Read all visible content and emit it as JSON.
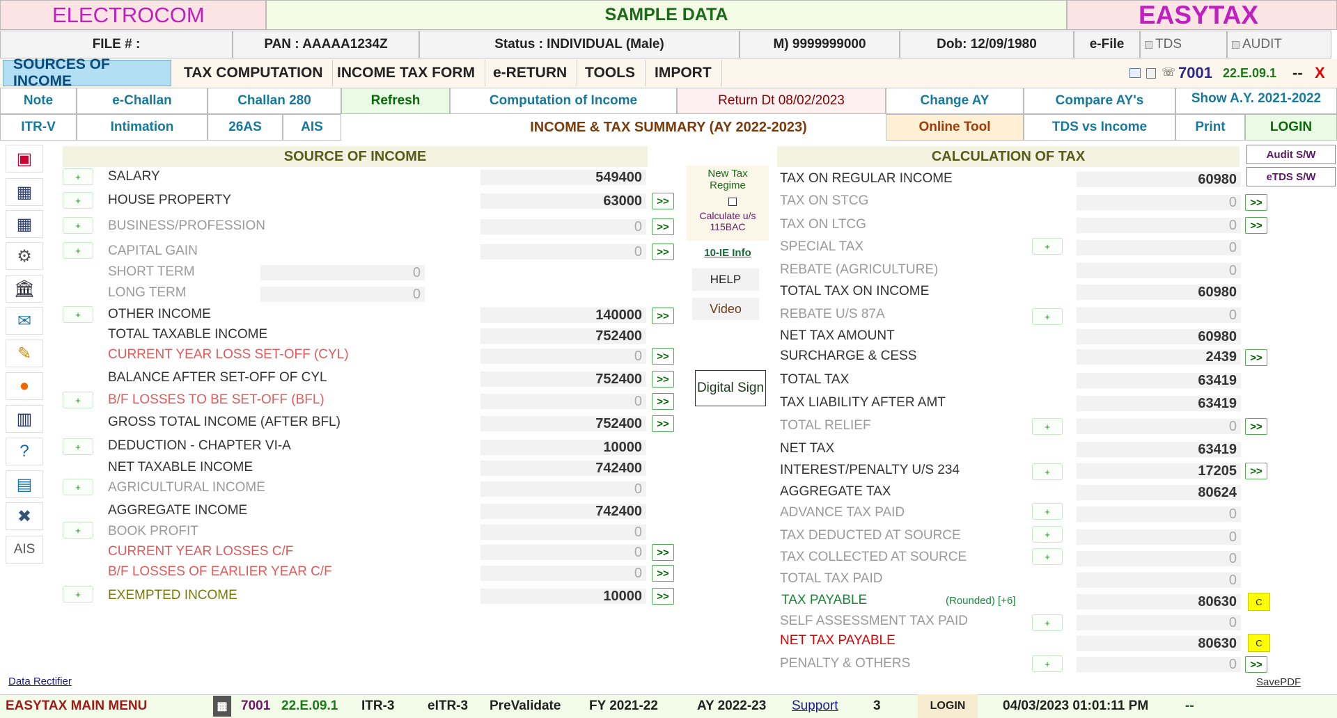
{
  "header": {
    "brand_left": "ELECTROCOM",
    "center": "SAMPLE DATA",
    "brand_right": "EASYTAX"
  },
  "info": {
    "file": "FILE # :",
    "pan": "PAN : AAAAA1234Z",
    "status": "Status : INDIVIDUAL (Male)",
    "mobile": "M) 9999999000",
    "dob": "Dob: 12/09/1980",
    "efile": "e-File",
    "tds": "TDS",
    "audit": "AUDIT"
  },
  "menu": {
    "sources": "SOURCES OF INCOME",
    "taxcomp": "TAX COMPUTATION",
    "itform": "INCOME TAX FORM",
    "ereturn": "e-RETURN",
    "tools": "TOOLS",
    "import": "IMPORT",
    "code": "7001",
    "version": "22.E.09.1",
    "dash": "--",
    "close": "X"
  },
  "buttons": {
    "note": "Note",
    "echallan": "e-Challan",
    "challan280": "Challan 280",
    "refresh": "Refresh",
    "comp": "Computation of Income",
    "returndt": "Return Dt 08/02/2023",
    "changeay": "Change AY",
    "compare": "Compare AY's",
    "showay": "Show A.Y. 2021-2022",
    "itrv": "ITR-V",
    "intimation": "Intimation",
    "26as": "26AS",
    "ais": "AIS",
    "summary": "INCOME & TAX SUMMARY (AY 2022-2023)",
    "online": "Online Tool",
    "tdsvs": "TDS vs Income",
    "print": "Print",
    "login": "LOGIN",
    "auditsw": "Audit S/W",
    "etdssw": "eTDS S/W"
  },
  "left": {
    "title": "SOURCE OF INCOME",
    "salary": "SALARY",
    "salary_v": "549400",
    "hp": "HOUSE PROPERTY",
    "hp_v": "63000",
    "bp": "BUSINESS/PROFESSION",
    "bp_v": "0",
    "cg": "CAPITAL GAIN",
    "cg_v": "0",
    "st": "SHORT TERM",
    "st_v": "0",
    "lt": "LONG TERM",
    "lt_v": "0",
    "oi": "OTHER INCOME",
    "oi_v": "140000",
    "tti": "TOTAL TAXABLE INCOME",
    "tti_v": "752400",
    "cyl": "CURRENT YEAR LOSS SET-OFF (CYL)",
    "cyl_v": "0",
    "bal": "BALANCE AFTER SET-OFF OF CYL",
    "bal_v": "752400",
    "bfl": "B/F LOSSES TO BE SET-OFF (BFL)",
    "bfl_v": "0",
    "gti": "GROSS TOTAL INCOME (AFTER BFL)",
    "gti_v": "752400",
    "ded": "DEDUCTION - CHAPTER VI-A",
    "ded_v": "10000",
    "nti": "NET TAXABLE INCOME",
    "nti_v": "742400",
    "agri": "AGRICULTURAL INCOME",
    "agri_v": "0",
    "agg": "AGGREGATE INCOME",
    "agg_v": "742400",
    "book": "BOOK PROFIT",
    "book_v": "0",
    "cylcf": "CURRENT YEAR LOSSES C/F",
    "cylcf_v": "0",
    "bfcf": "B/F LOSSES OF EARLIER YEAR C/F",
    "bfcf_v": "0",
    "exm": "EXEMPTED INCOME",
    "exm_v": "10000"
  },
  "mid": {
    "newtax": "New Tax Regime",
    "calc": "Calculate u/s 115BAC",
    "ie": "10-IE Info",
    "help": "HELP",
    "video": "Video",
    "digital": "Digital Sign"
  },
  "right": {
    "title": "CALCULATION OF TAX",
    "reg": "TAX ON REGULAR INCOME",
    "reg_v": "60980",
    "stcg": "TAX ON STCG",
    "stcg_v": "0",
    "ltcg": "TAX ON LTCG",
    "ltcg_v": "0",
    "spl": "SPECIAL TAX",
    "spl_v": "0",
    "reb": "REBATE (AGRICULTURE)",
    "reb_v": "0",
    "tot": "TOTAL TAX ON INCOME",
    "tot_v": "60980",
    "r87": "REBATE U/S 87A",
    "r87_v": "0",
    "net": "NET TAX AMOUNT",
    "net_v": "60980",
    "sur": "SURCHARGE & CESS",
    "sur_v": "2439",
    "ttax": "TOTAL TAX",
    "ttax_v": "63419",
    "amt": "TAX LIABILITY AFTER AMT",
    "amt_v": "63419",
    "rel": "TOTAL RELIEF",
    "rel_v": "0",
    "ntax": "NET TAX",
    "ntax_v": "63419",
    "int": "INTEREST/PENALTY U/S 234",
    "int_v": "17205",
    "aggt": "AGGREGATE TAX",
    "aggt_v": "80624",
    "adv": "ADVANCE TAX PAID",
    "adv_v": "0",
    "tds": "TAX DEDUCTED AT SOURCE",
    "tds_v": "0",
    "tcs": "TAX COLLECTED AT SOURCE",
    "tcs_v": "0",
    "ttp": "TOTAL TAX PAID",
    "ttp_v": "0",
    "pay": "TAX PAYABLE",
    "rounded": "(Rounded) [+6]",
    "pay_v": "80630",
    "sat": "SELF ASSESSMENT TAX PAID",
    "sat_v": "0",
    "ntp": "NET TAX PAYABLE",
    "ntp_v": "80630",
    "pen": "PENALTY & OTHERS",
    "pen_v": "0",
    "c": "C"
  },
  "icons": {
    "ais": "AIS"
  },
  "links": {
    "rectifier": "Data Rectifier",
    "savepdf": "SavePDF"
  },
  "footer": {
    "menu": "EASYTAX MAIN MENU",
    "code": "7001",
    "version": "22.E.09.1",
    "itr3": "ITR-3",
    "eitr3": "eITR-3",
    "preval": "PreValidate",
    "fy": "FY 2021-22",
    "ay": "AY 2022-23",
    "support": "Support",
    "count": "3",
    "login": "LOGIN",
    "datetime": "04/03/2023 01:01:11 PM",
    "dash": "--"
  }
}
